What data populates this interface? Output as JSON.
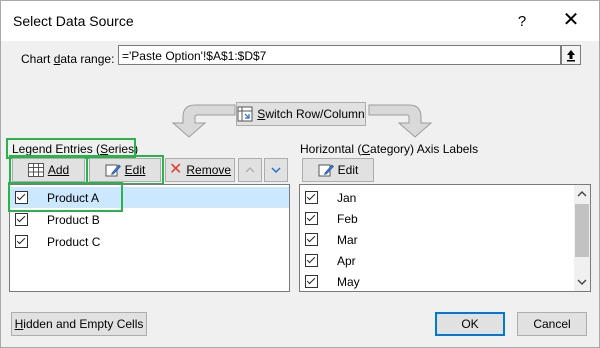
{
  "dialog": {
    "title": "Select Data Source",
    "help_label": "?",
    "close_label": "✕"
  },
  "range": {
    "label": "Chart data range:",
    "value": "='Paste Option'!$A$1:$D$7"
  },
  "switch_label": "Switch Row/Column",
  "legend": {
    "title": "Legend Entries (Series)",
    "add_label": "Add",
    "edit_label": "Edit",
    "remove_label": "Remove",
    "items": [
      {
        "label": "Product A",
        "checked": true,
        "selected": true
      },
      {
        "label": "Product B",
        "checked": true,
        "selected": false
      },
      {
        "label": "Product C",
        "checked": true,
        "selected": false
      }
    ]
  },
  "axis": {
    "title": "Horizontal (Category) Axis Labels",
    "edit_label": "Edit",
    "items": [
      {
        "label": "Jan",
        "checked": true
      },
      {
        "label": "Feb",
        "checked": true
      },
      {
        "label": "Mar",
        "checked": true
      },
      {
        "label": "Apr",
        "checked": true
      },
      {
        "label": "May",
        "checked": true
      }
    ]
  },
  "footer": {
    "hidden_label": "Hidden and Empty Cells",
    "ok_label": "OK",
    "cancel_label": "Cancel"
  },
  "colors": {
    "highlight": "#2bb24c",
    "selection": "#cce8ff",
    "accent": "#0078d7",
    "remove_icon": "#e03c31"
  }
}
